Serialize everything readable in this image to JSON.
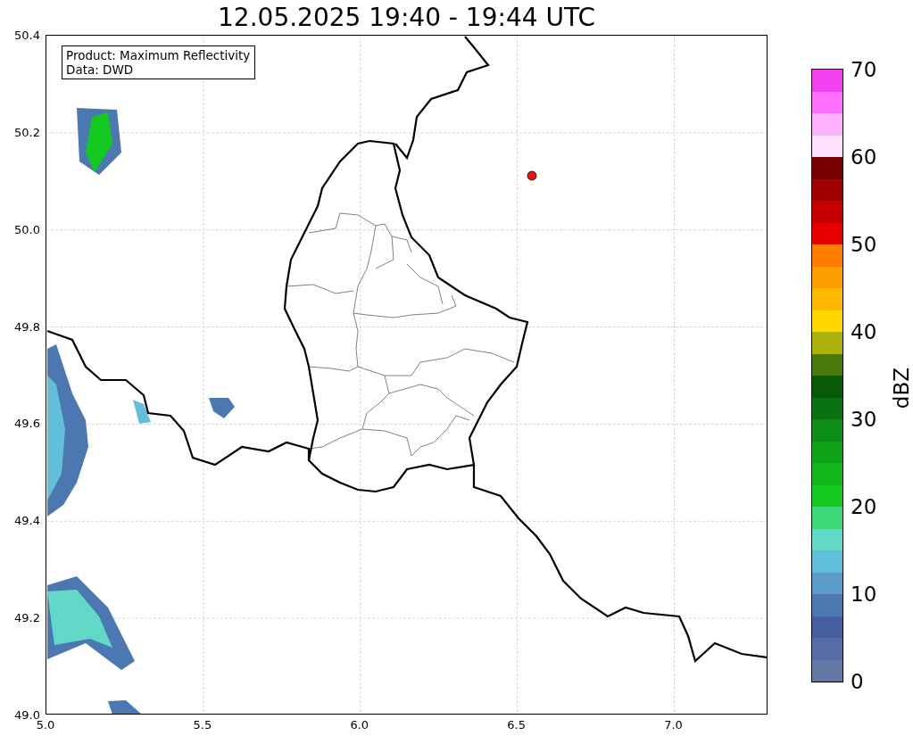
{
  "title": "12.05.2025 19:40 - 19:44 UTC",
  "legend": [
    "Product: Maximum Reflectivity",
    "Data: DWD"
  ],
  "x_ticks": [
    "5.0",
    "5.5",
    "6.0",
    "6.5",
    "7.0"
  ],
  "y_ticks": [
    "50.4",
    "50.2",
    "50.0",
    "49.8",
    "49.6",
    "49.4",
    "49.2",
    "49.0"
  ],
  "colorbar": {
    "label": "dBZ",
    "ticks": [
      "70",
      "60",
      "50",
      "40",
      "30",
      "20",
      "10",
      "0"
    ],
    "bands": [
      {
        "color": "#6478a8"
      },
      {
        "color": "#576ca6"
      },
      {
        "color": "#445fa0"
      },
      {
        "color": "#4b78b0"
      },
      {
        "color": "#5b9dca"
      },
      {
        "color": "#62bfd9"
      },
      {
        "color": "#62d8c8"
      },
      {
        "color": "#3fd878"
      },
      {
        "color": "#13c81f"
      },
      {
        "color": "#10b81a"
      },
      {
        "color": "#0fa418"
      },
      {
        "color": "#0e8c18"
      },
      {
        "color": "#0a7212"
      },
      {
        "color": "#075a0a"
      },
      {
        "color": "#4a7a0c"
      },
      {
        "color": "#aeb00a"
      },
      {
        "color": "#ffd700"
      },
      {
        "color": "#ffb800"
      },
      {
        "color": "#ff9e00"
      },
      {
        "color": "#ff7e00"
      },
      {
        "color": "#e60000"
      },
      {
        "color": "#c60000"
      },
      {
        "color": "#a00000"
      },
      {
        "color": "#780000"
      },
      {
        "color": "#ffe0ff"
      },
      {
        "color": "#ffb0ff"
      },
      {
        "color": "#ff70ff"
      },
      {
        "color": "#f040f0"
      }
    ]
  }
}
